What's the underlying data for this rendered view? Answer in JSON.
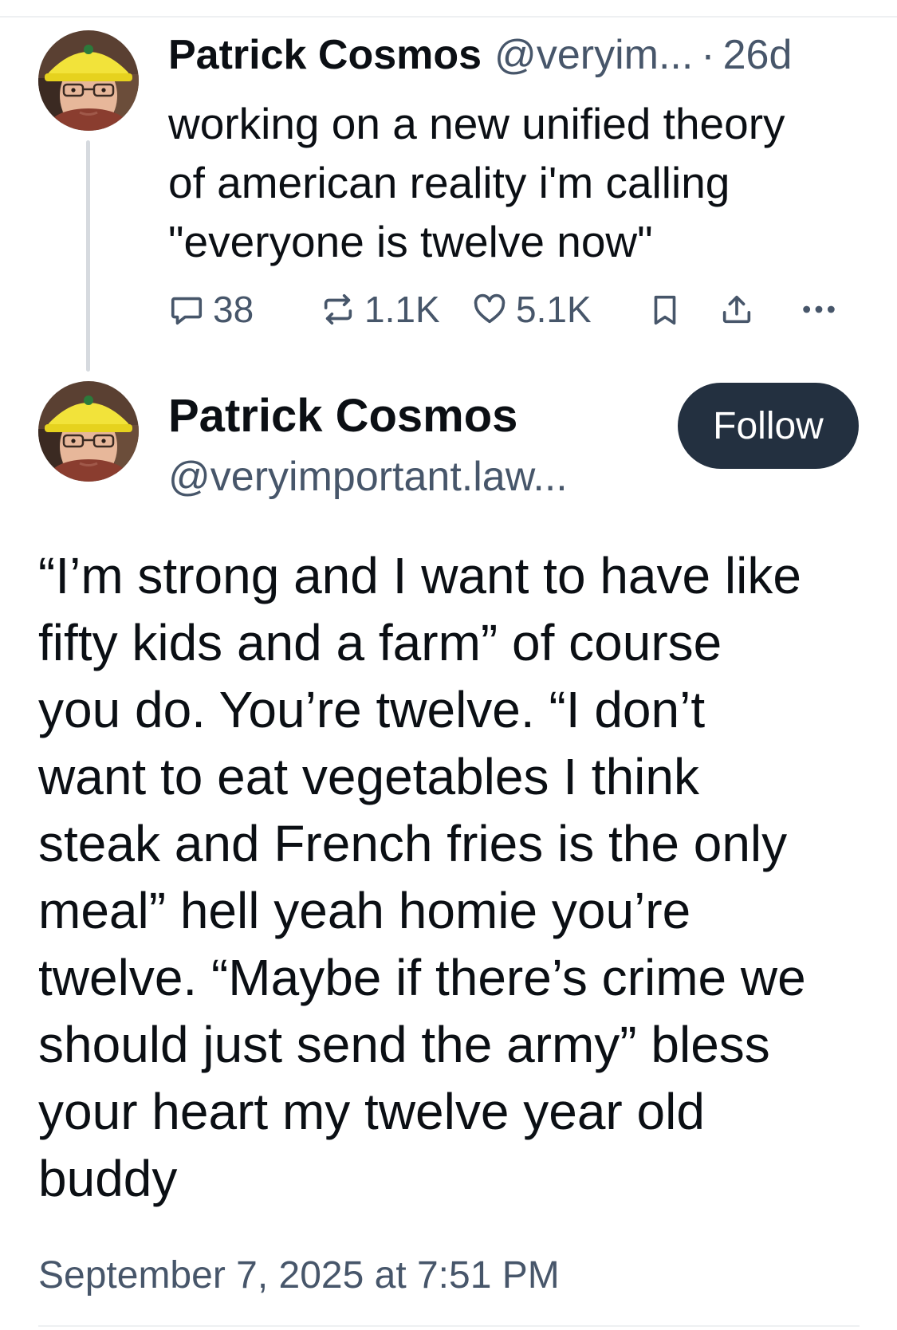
{
  "thread_parent": {
    "author_name": "Patrick Cosmos",
    "handle": "@veryim...",
    "separator": "·",
    "time": "26d",
    "text_lines": [
      "working on a new unified theory",
      "of american reality i'm calling",
      "\"everyone is twelve now\""
    ],
    "stats": {
      "replies": "38",
      "reposts": "1.1K",
      "likes": "5.1K"
    },
    "icons": [
      "reply-icon",
      "repost-icon",
      "like-icon",
      "bookmark-icon",
      "share-icon",
      "more-icon"
    ]
  },
  "main_post": {
    "author_name": "Patrick Cosmos",
    "handle": "@veryimportant.law...",
    "follow_label": "Follow",
    "text_lines": [
      "“I’m strong and I want to have like",
      "fifty kids and a farm” of course",
      "you do. You’re twelve. “I don’t",
      "want to eat vegetables I think",
      "steak and French fries is the only",
      "meal” hell yeah homie you’re",
      "twelve. “Maybe if there’s crime we",
      "should just send the army” bless",
      "your heart my twelve year old",
      "buddy"
    ],
    "timestamp": "September 7, 2025 at 7:51 PM"
  },
  "colors": {
    "text": "#0b0f14",
    "muted": "#47566a",
    "follow_button_bg": "#233040",
    "thread_line": "#d6dadf"
  }
}
